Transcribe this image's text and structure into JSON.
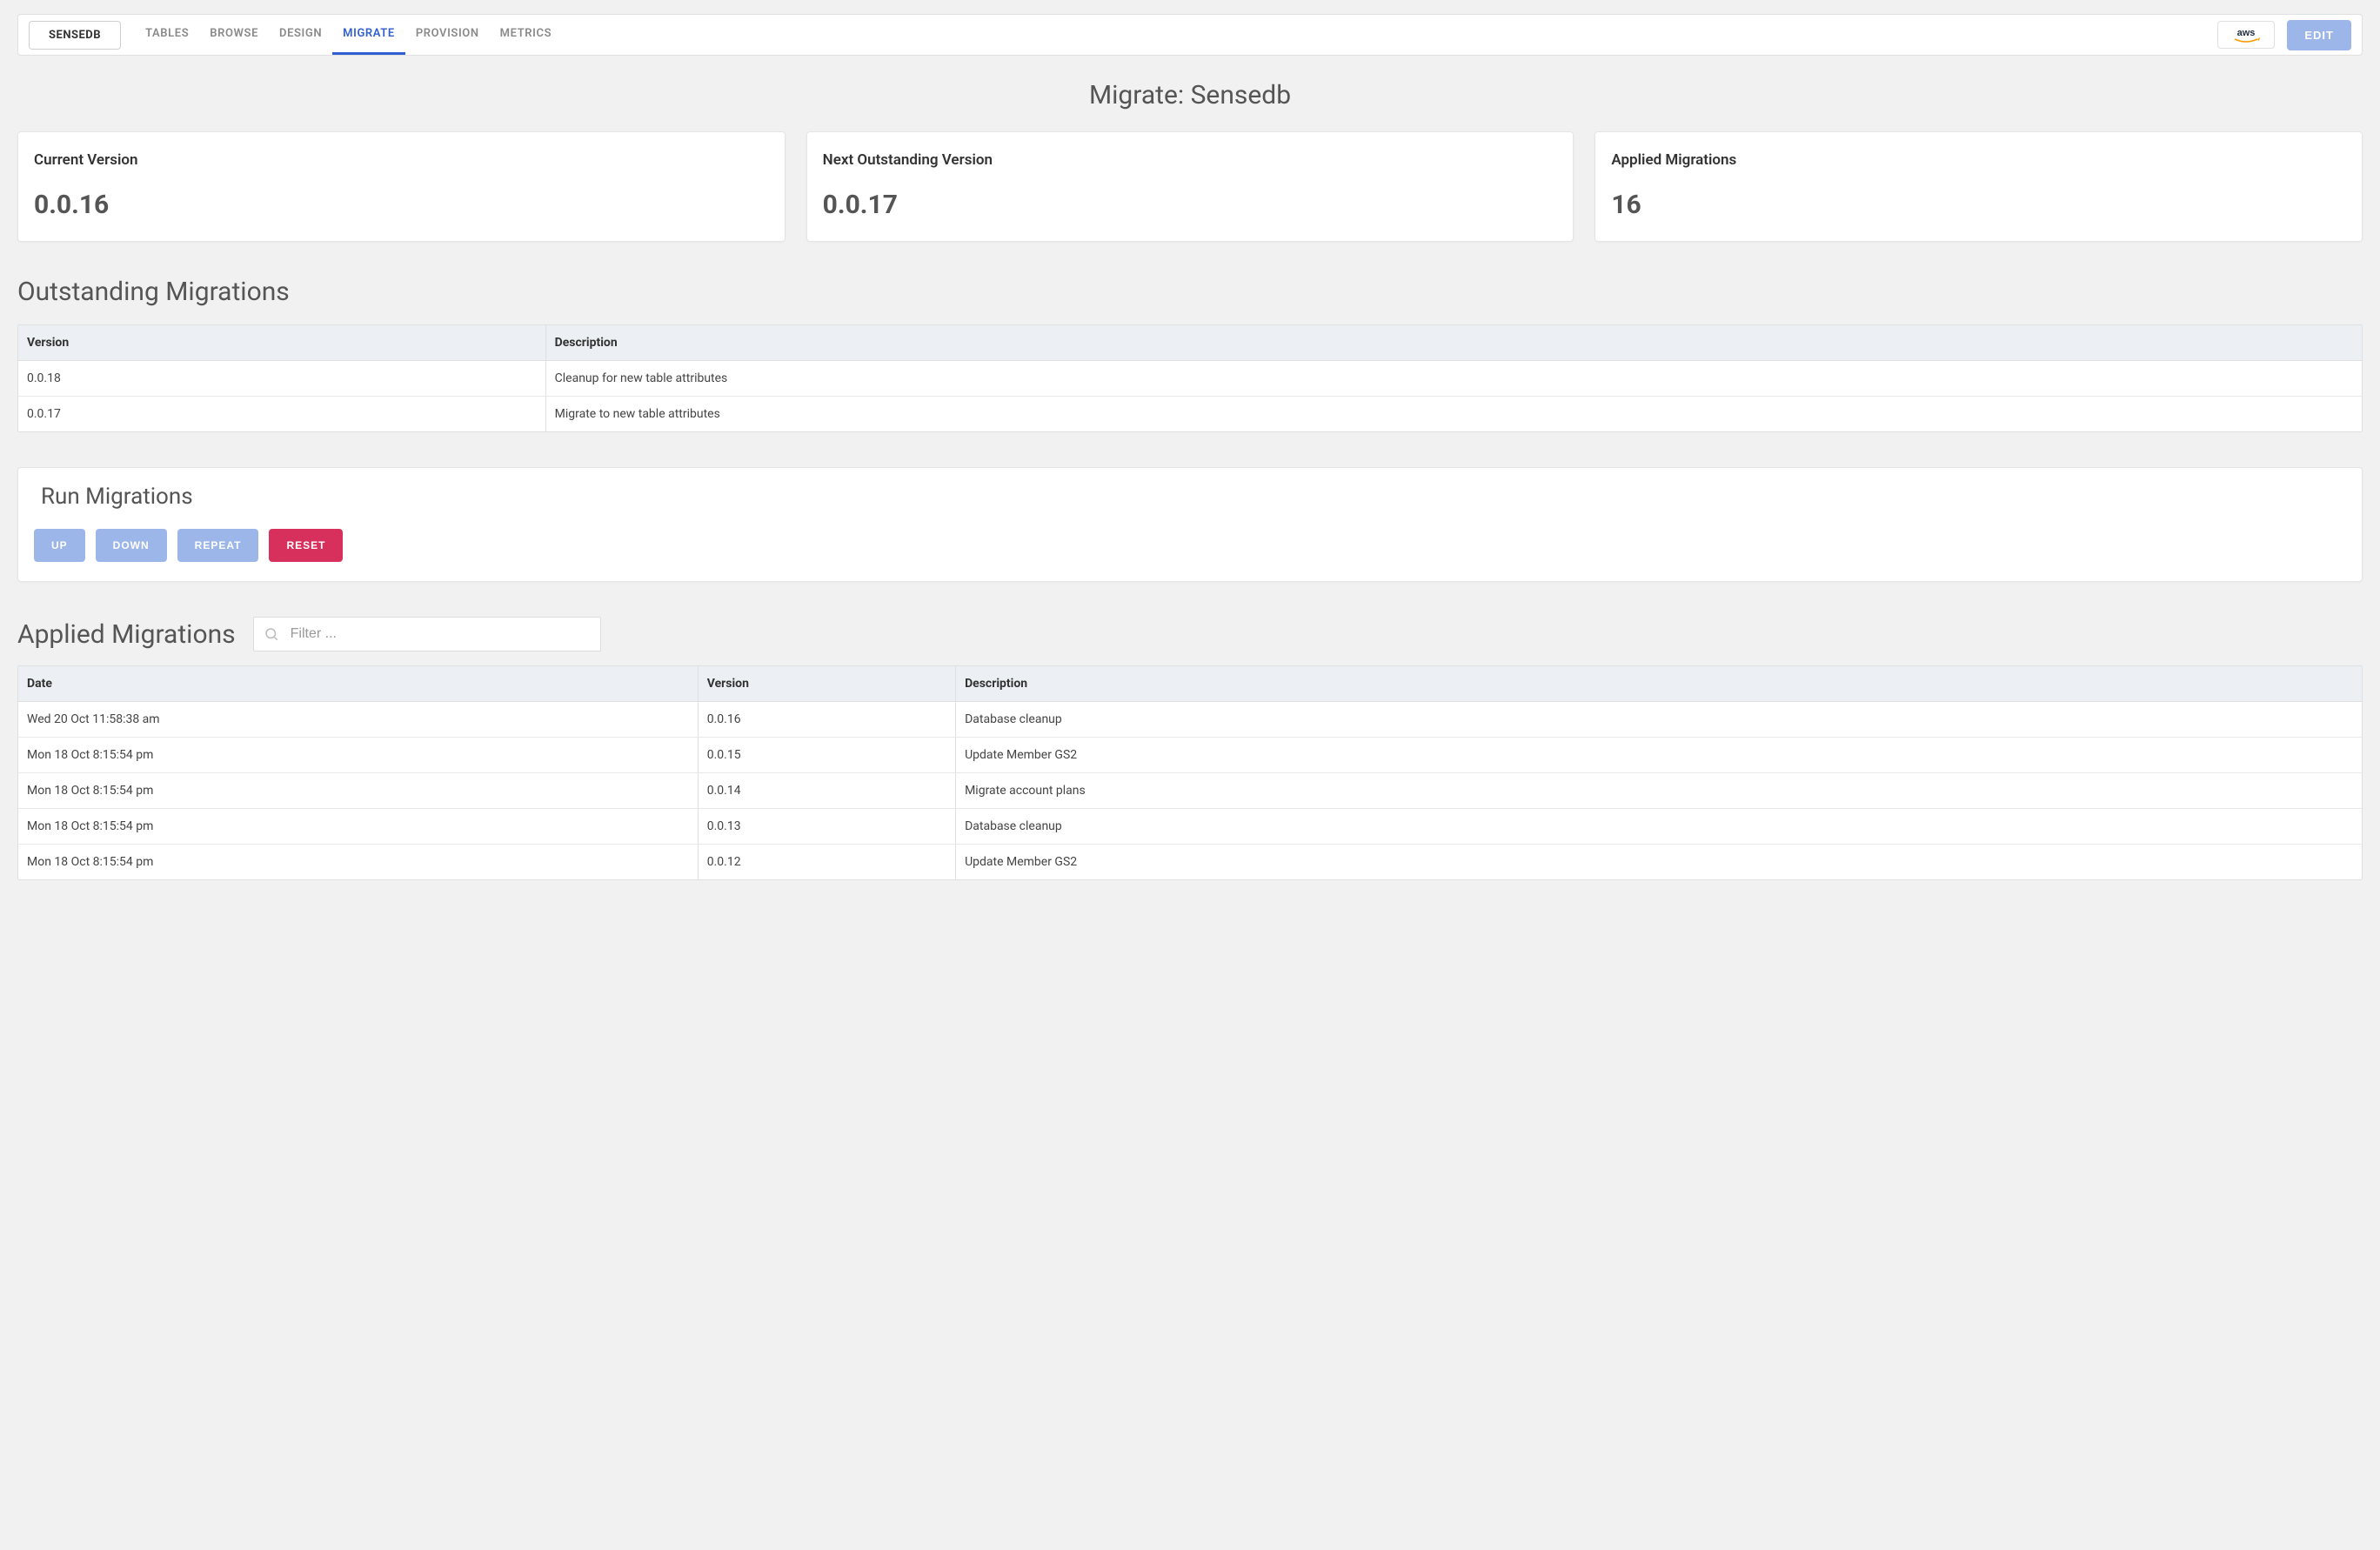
{
  "header": {
    "db_label": "SENSEDB",
    "nav": [
      "TABLES",
      "BROWSE",
      "DESIGN",
      "MIGRATE",
      "PROVISION",
      "METRICS"
    ],
    "active_nav_index": 3,
    "edit_label": "EDIT"
  },
  "page_title": "Migrate: Sensedb",
  "cards": [
    {
      "label": "Current Version",
      "value": "0.0.16"
    },
    {
      "label": "Next Outstanding Version",
      "value": "0.0.17"
    },
    {
      "label": "Applied Migrations",
      "value": "16"
    }
  ],
  "outstanding": {
    "title": "Outstanding Migrations",
    "headers": [
      "Version",
      "Description"
    ],
    "rows": [
      {
        "version": "0.0.18",
        "description": "Cleanup for new table attributes"
      },
      {
        "version": "0.0.17",
        "description": "Migrate to new table attributes"
      }
    ]
  },
  "run": {
    "title": "Run Migrations",
    "buttons": {
      "up": "UP",
      "down": "DOWN",
      "repeat": "REPEAT",
      "reset": "RESET"
    }
  },
  "applied": {
    "title": "Applied Migrations",
    "filter_placeholder": "Filter ...",
    "headers": [
      "Date",
      "Version",
      "Description"
    ],
    "rows": [
      {
        "date": "Wed 20 Oct 11:58:38 am",
        "version": "0.0.16",
        "description": "Database cleanup"
      },
      {
        "date": "Mon 18 Oct 8:15:54 pm",
        "version": "0.0.15",
        "description": "Update Member GS2"
      },
      {
        "date": "Mon 18 Oct 8:15:54 pm",
        "version": "0.0.14",
        "description": "Migrate account plans"
      },
      {
        "date": "Mon 18 Oct 8:15:54 pm",
        "version": "0.0.13",
        "description": "Database cleanup"
      },
      {
        "date": "Mon 18 Oct 8:15:54 pm",
        "version": "0.0.12",
        "description": "Update Member GS2"
      }
    ]
  }
}
